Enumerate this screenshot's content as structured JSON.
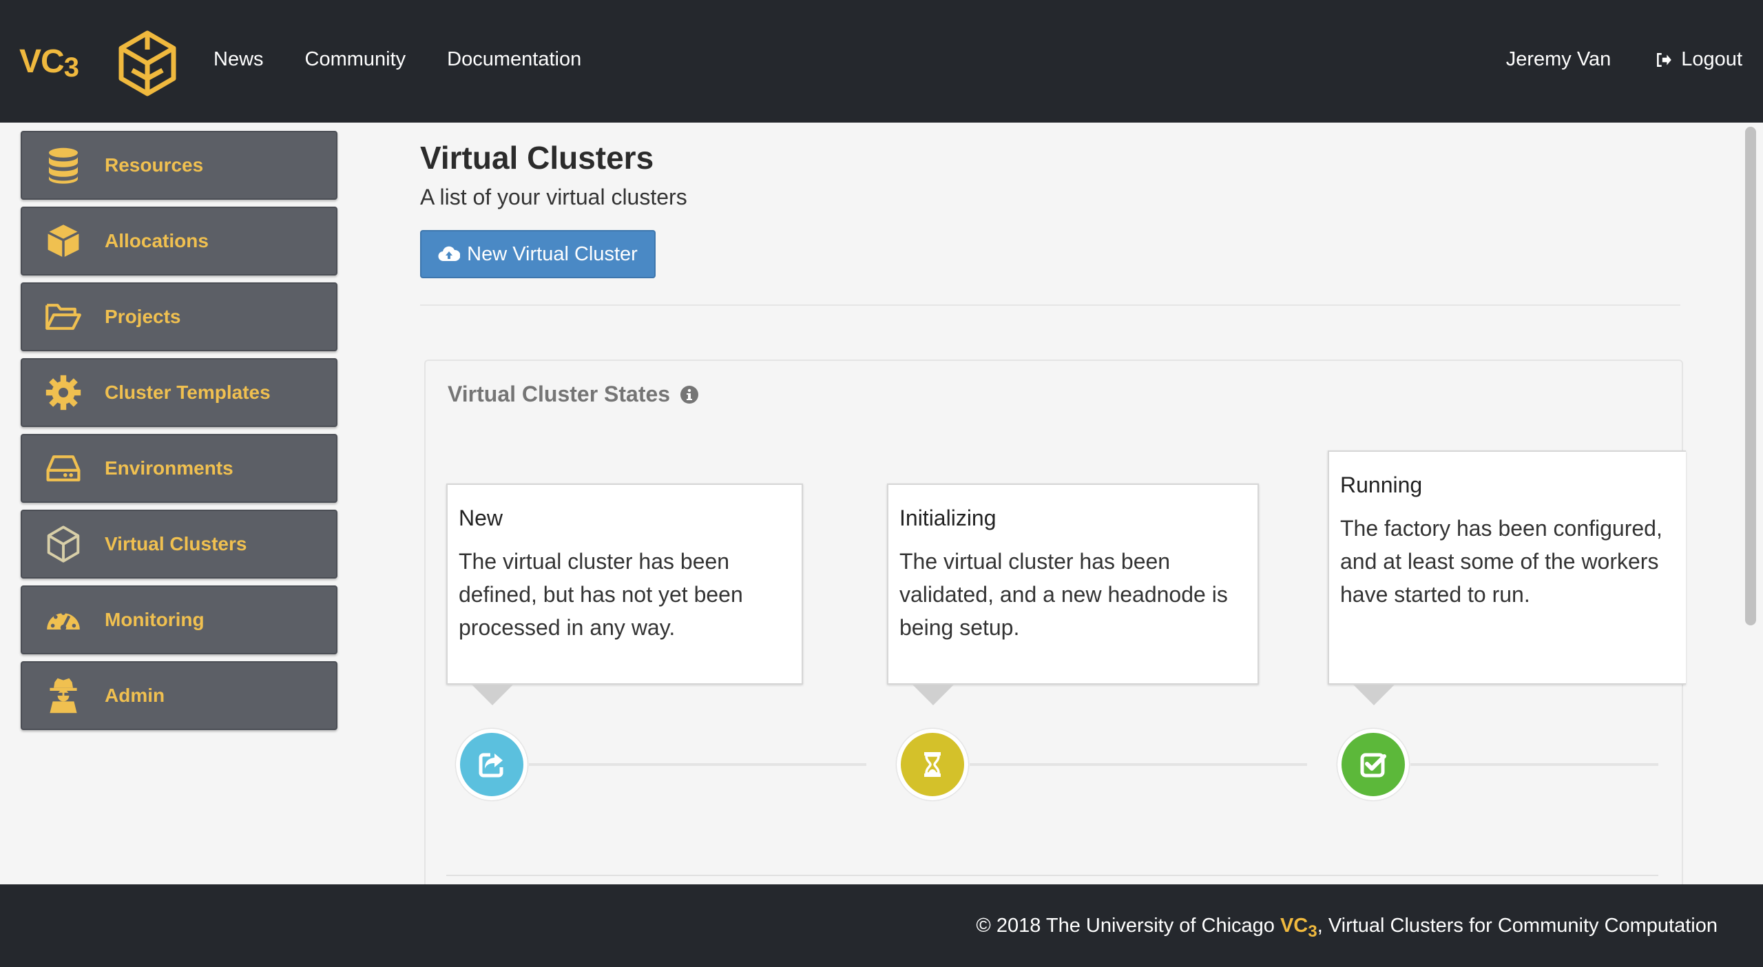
{
  "nav": {
    "brand": "VC",
    "brand_sub": "3",
    "links": [
      "News",
      "Community",
      "Documentation"
    ],
    "user": "Jeremy Van",
    "logout": "Logout"
  },
  "sidebar": {
    "items": [
      {
        "label": "Resources",
        "icon": "database-icon"
      },
      {
        "label": "Allocations",
        "icon": "cube-icon"
      },
      {
        "label": "Projects",
        "icon": "folder-open-icon"
      },
      {
        "label": "Cluster Templates",
        "icon": "gear-icon"
      },
      {
        "label": "Environments",
        "icon": "hdd-icon"
      },
      {
        "label": "Virtual Clusters",
        "icon": "vc3-logo-icon"
      },
      {
        "label": "Monitoring",
        "icon": "dashboard-icon"
      },
      {
        "label": "Admin",
        "icon": "user-secret-icon"
      }
    ]
  },
  "main": {
    "title": "Virtual Clusters",
    "subtitle": "A list of your virtual clusters",
    "new_button": "New Virtual Cluster",
    "panel_title": "Virtual Cluster States",
    "states": [
      {
        "title": "New",
        "desc": "The virtual cluster has been defined, but has not yet been processed in any way.",
        "color": "#5bc0de",
        "icon": "share-icon"
      },
      {
        "title": "Initializing",
        "desc": "The virtual cluster has been validated, and a new headnode is being setup.",
        "color": "#d4c12a",
        "icon": "hourglass-icon"
      },
      {
        "title": "Running",
        "desc": "The factory has been configured, and at least some of the workers have started to run.",
        "color": "#5cb83a",
        "icon": "check-square-icon"
      }
    ]
  },
  "footer": {
    "prefix": "© 2018 The University of Chicago",
    "brand": "VC",
    "brand_sub": "3",
    "suffix": ", Virtual Clusters for Community Computation"
  },
  "colors": {
    "navbar": "#25282d",
    "accent": "#f0b93e",
    "sidebar_item": "#5c5f66",
    "button": "#4a89c5"
  }
}
